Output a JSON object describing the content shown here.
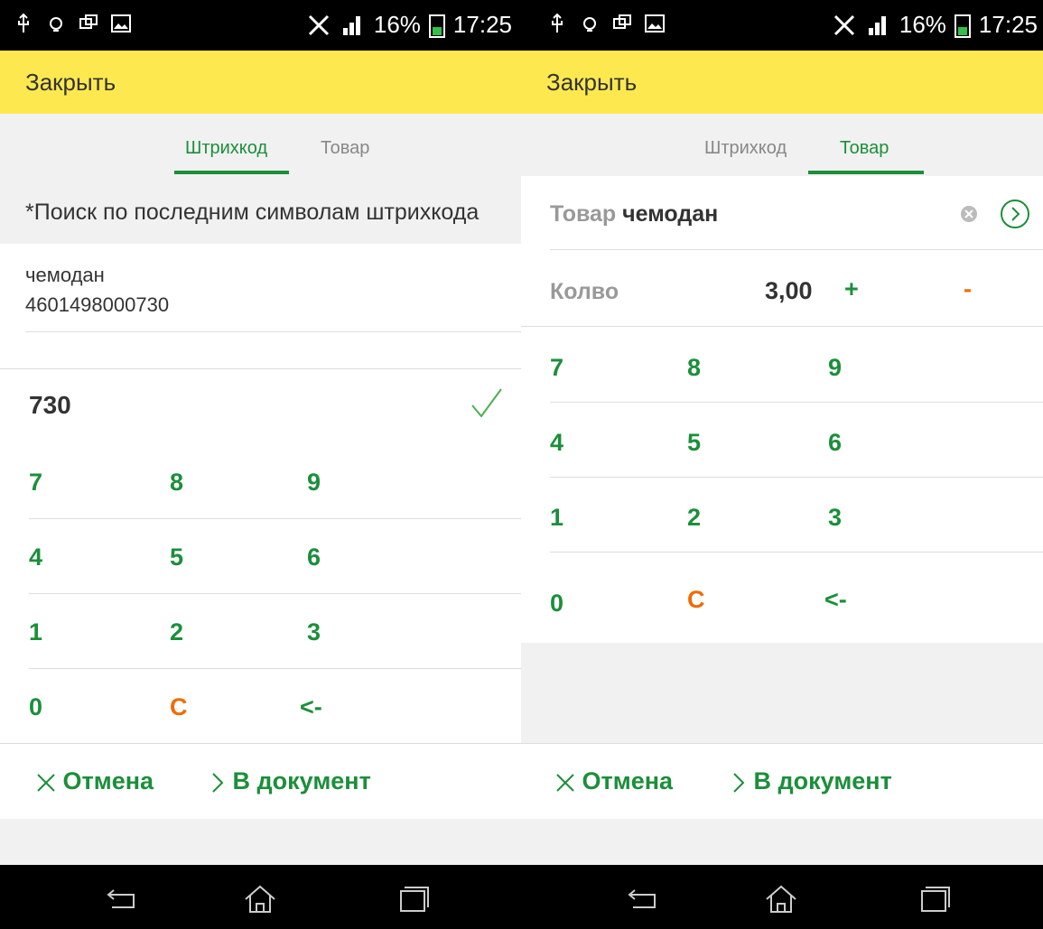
{
  "status": {
    "battery": "16%",
    "time": "17:25"
  },
  "left": {
    "close_label": "Закрыть",
    "tabs": [
      {
        "label": "Штрихкод"
      },
      {
        "label": "Товар"
      }
    ],
    "hint": "*Поиск по последним символам штрихкода",
    "result": {
      "name": "чемодан",
      "code": "4601498000730"
    },
    "input_value": "730",
    "keys": [
      "7",
      "8",
      "9",
      "4",
      "5",
      "6",
      "1",
      "2",
      "3",
      "0",
      "C",
      "<-"
    ],
    "cancel_label": "Отмена",
    "to_doc_label": "В документ"
  },
  "right": {
    "close_label": "Закрыть",
    "tabs": [
      {
        "label": "Штрихкод"
      },
      {
        "label": "Товар"
      }
    ],
    "product_label": "Товар",
    "product_value": "чемодан",
    "qty_label": "Колво",
    "qty_value": "3,00",
    "plus": "+",
    "minus": "-",
    "keys": [
      "7",
      "8",
      "9",
      "4",
      "5",
      "6",
      "1",
      "2",
      "3",
      "0",
      "C",
      "<-"
    ],
    "cancel_label": "Отмена",
    "to_doc_label": "В документ"
  },
  "colors": {
    "green": "#1b8f3a",
    "orange": "#ef6c00",
    "yellow": "#fde94f"
  }
}
